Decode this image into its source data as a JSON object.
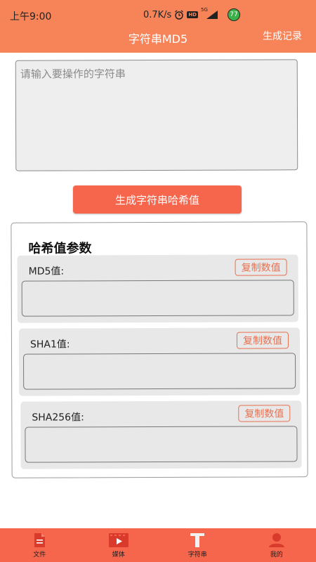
{
  "status_bar": {
    "time": "上午9:00",
    "net_speed": "0.7K/s",
    "hd_badge": "HD",
    "signal_label": "5G",
    "battery_badge": "77"
  },
  "header": {
    "title": "字符串MD5",
    "history_link": "生成记录"
  },
  "input": {
    "placeholder": "请输入要操作的字符串",
    "value": ""
  },
  "generate_button": "生成字符串哈希值",
  "results": {
    "title": "哈希值参数",
    "items": [
      {
        "label": "MD5值:",
        "copy_label": "复制数值",
        "value": ""
      },
      {
        "label": "SHA1值:",
        "copy_label": "复制数值",
        "value": ""
      },
      {
        "label": "SHA256值:",
        "copy_label": "复制数值",
        "value": ""
      }
    ]
  },
  "bottom_nav": [
    {
      "label": "文件",
      "icon": "file-icon"
    },
    {
      "label": "媒体",
      "icon": "media-icon"
    },
    {
      "label": "字符串",
      "icon": "text-icon"
    },
    {
      "label": "我的",
      "icon": "user-icon"
    }
  ],
  "colors": {
    "header_bg": "#f68458",
    "accent": "#f5664d",
    "copy_border": "#e8704f",
    "nav_icon": "#d93a2b"
  }
}
